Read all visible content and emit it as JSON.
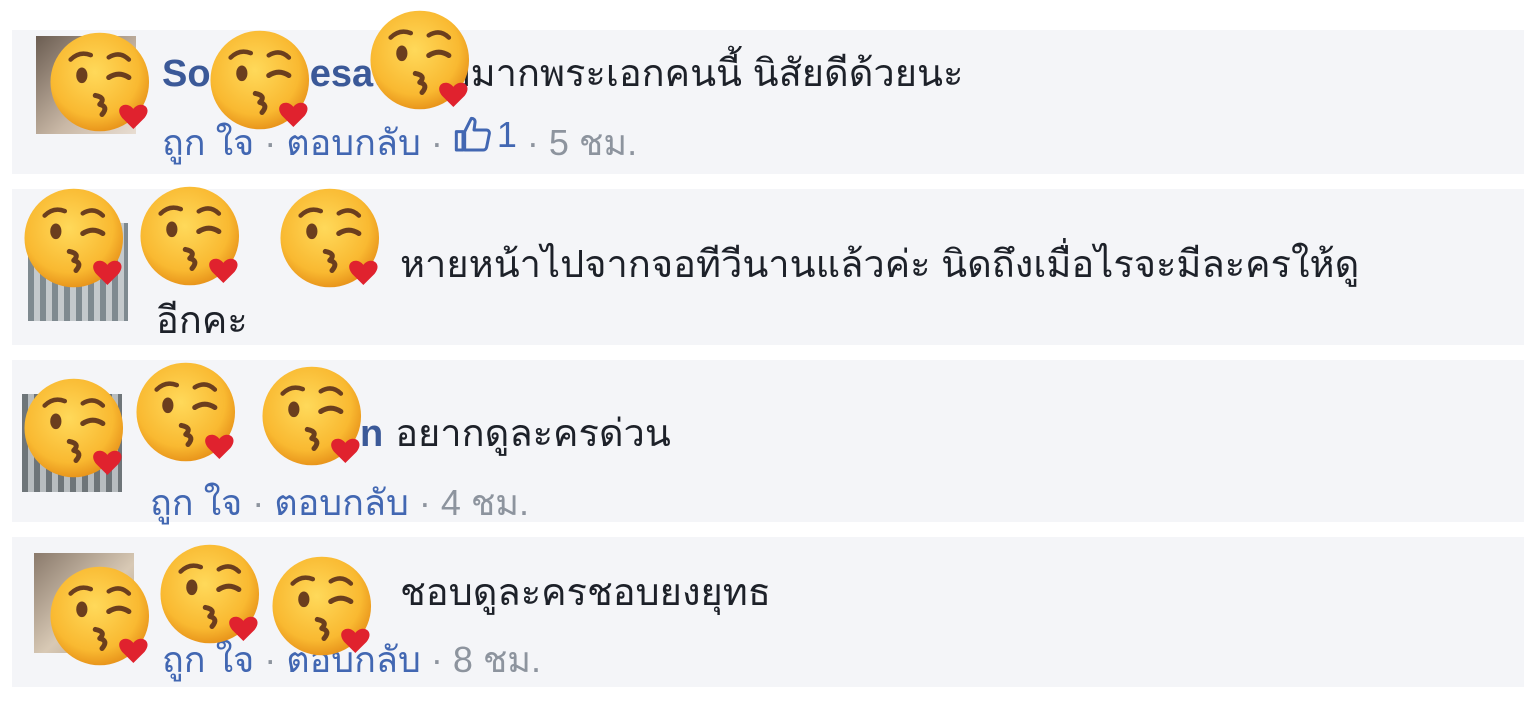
{
  "comments": [
    {
      "name": "So  k  Th  esat",
      "text": "ชอบมากพระเอกคนนี้ นิสัยดีด้วยนะ",
      "actions": {
        "like": "ถูก ใจ",
        "reply": "ตอบกลับ",
        "like_count": "1",
        "time": "5 ชม."
      }
    },
    {
      "name": "",
      "text": "หายหน้าไปจากจอทีวีนานแล้วค่ะ นิดถึงเมื่อไรจะมีละครให้ดู",
      "text2": "อีกคะ"
    },
    {
      "name": "n",
      "text": "อยากดูละครด่วน",
      "actions": {
        "like": "ถูก ใจ",
        "reply": "ตอบกลับ",
        "time": "4 ชม."
      }
    },
    {
      "name": "",
      "text": "ชอบดูละครชอบยงยุทธ",
      "actions": {
        "like": "ถูก ใจ",
        "reply": "ตอบกลับ",
        "time": "8 ชม."
      }
    }
  ],
  "icons": {
    "sticker": "kissing-face-with-heart-emoji",
    "like": "thumbs-up-icon"
  },
  "colors": {
    "name_link": "#3b5998",
    "action_link": "#4267b2",
    "muted": "#8d949e",
    "card_bg": "#f4f5f8",
    "emoji": "#f9b931",
    "heart": "#e0222e"
  }
}
